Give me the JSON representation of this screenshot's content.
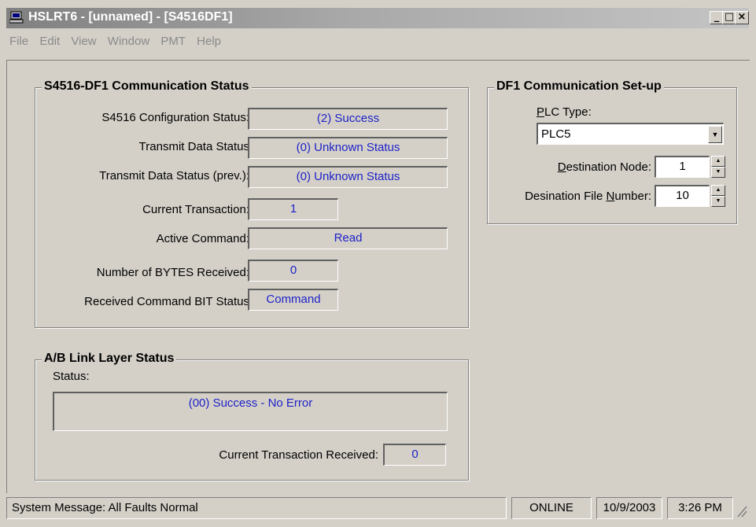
{
  "window": {
    "title": "HSLRT6 - [unnamed] - [S4516DF1]",
    "controls": {
      "minimize": "_",
      "maximize": "□",
      "close": "×"
    }
  },
  "menu": [
    "File",
    "Edit",
    "View",
    "Window",
    "PMT",
    "Help"
  ],
  "comm_status": {
    "title": "S4516-DF1 Communication Status",
    "rows": [
      {
        "label": "S4516 Configuration Status:",
        "value": "(2) Success"
      },
      {
        "label": "Transmit Data Status",
        "value": "(0) Unknown Status"
      },
      {
        "label": "Transmit Data Status (prev.):",
        "value": "(0) Unknown Status"
      },
      {
        "label": "Current Transaction:",
        "value": "1"
      },
      {
        "label": "Active Command:",
        "value": "Read"
      },
      {
        "label": "Number of BYTES Received:",
        "value": "0"
      },
      {
        "label": "Received Command BIT Status",
        "value": "Command"
      }
    ]
  },
  "link_layer": {
    "title": "A/B Link Layer Status",
    "status_label": "Status:",
    "status_value": "(00) Success - No Error",
    "current_tx_label": "Current Transaction Received:",
    "current_tx_value": "0"
  },
  "df1_setup": {
    "title": "DF1 Communication Set-up",
    "plc_type_label": {
      "accel": "P",
      "rest": "LC Type:"
    },
    "plc_type_value": "PLC5",
    "dest_node_label": {
      "accel": "D",
      "rest": "estination Node:"
    },
    "dest_node_value": "1",
    "dest_file_label": {
      "pre": "Desination File ",
      "accel": "N",
      "rest": "umber:"
    },
    "dest_file_value": "10"
  },
  "statusbar": {
    "message": "System Message:  All Faults Normal",
    "mode": "ONLINE",
    "date": "10/9/2003",
    "time": "3:26 PM"
  },
  "colors": {
    "value_text": "#1e22c8",
    "face": "#d4d0c8"
  },
  "icons": {
    "app": "computer-icon",
    "dropdown": "chevron-down-icon",
    "spin_up": "spin-up-icon",
    "spin_down": "spin-down-icon",
    "grip": "resize-grip-icon"
  }
}
